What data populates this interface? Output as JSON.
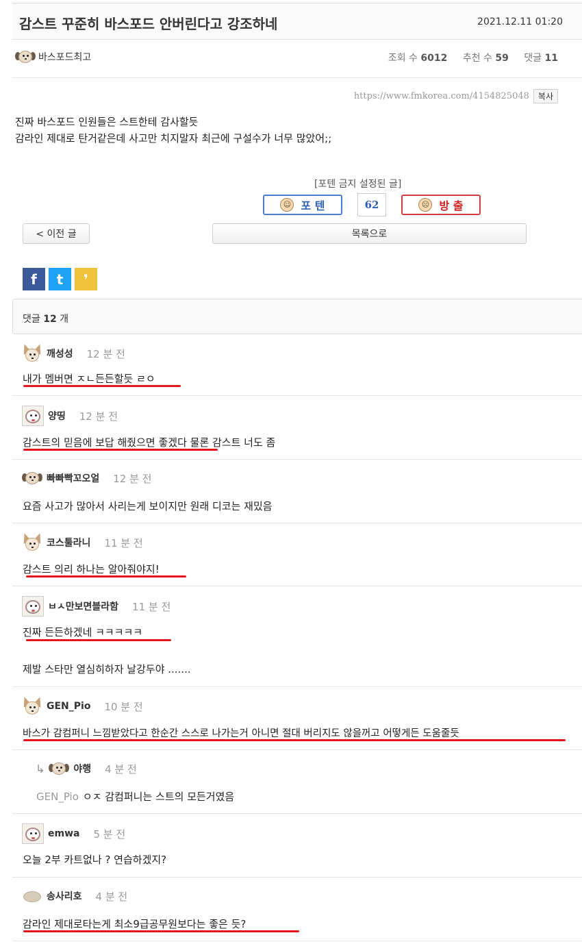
{
  "post": {
    "title": "감스트 꾸준히 바스포드 안버린다고 강조하네",
    "date": "2021.12.11 01:20",
    "author": "바스포드최고",
    "views_label": "조회 수",
    "views": "6012",
    "likes_label": "추천 수",
    "likes": "59",
    "comments_label": "댓글",
    "comments": "11",
    "url": "https://www.fmkorea.com/4154825048",
    "copy_label": "복사",
    "body_lines": [
      "진짜 바스포드 인원들은 스트한테 감사할듯",
      "감라인 제대로 탄거같은데 사고만 치지말자 최근에 구설수가 너무 많았어;;"
    ]
  },
  "vote": {
    "ban_note": "[포텐 금지 설정된 글]",
    "up_label": "포 텐",
    "count": "62",
    "down_label": "방 출"
  },
  "nav": {
    "prev_label": "< 이전 글",
    "list_label": "목록으로"
  },
  "share": {
    "facebook": "f",
    "twitter": "t",
    "kakao": "❜"
  },
  "comment_header": {
    "prefix": "댓글",
    "count": "12",
    "suffix": "개"
  },
  "comments": [
    {
      "avatar": "fox-icon",
      "name": "깨성성",
      "time": "12 분 전",
      "text": "내가 멤버면 ㅈㄴ든든할듯 ㄹㅇ"
    },
    {
      "avatar": "puppy-icon",
      "name": "양띵",
      "time": "12 분 전",
      "text": "감스트의 믿음에 보답 해줬으면 좋겠다 물론 감스트 너도 좀"
    },
    {
      "avatar": "dog-icon",
      "name": "빠빠빡꼬오얼",
      "time": "12 분 전",
      "text": "요즘 사고가 많아서 사리는게 보이지만 원래 디코는 재밌음"
    },
    {
      "avatar": "fox-icon",
      "name": "코스툴라니",
      "time": "11 분 전",
      "text": "감스트 의리 하나는 알아줘야지!"
    },
    {
      "avatar": "puppy-icon",
      "name": "ㅂㅅ만보면블라함",
      "time": "11 분 전",
      "text": "진짜 든든하겠네 ㅋㅋㅋㅋㅋ",
      "text2": "제발 스타만 열심히하자 날강두야 ......."
    },
    {
      "avatar": "fox-icon",
      "name": "GEN_Pio",
      "time": "10 분 전",
      "text": "바스가 감컴퍼니 느낌받았다고 한순간 스스로 나가는거 아니면 절대 버리지도 않을꺼고 어떻게든 도움줄듯"
    },
    {
      "avatar": "dog-icon",
      "name": "야행",
      "time": "4 분 전",
      "reply_to": "GEN_Pio",
      "text": "ㅇㅈ 감컴퍼니는 스트의 모든거였음"
    },
    {
      "avatar": "puppy-icon",
      "name": "emwa",
      "time": "5 분 전",
      "text": "오늘 2부 카트없나 ? 연습하겠지?"
    },
    {
      "avatar": "blob-icon",
      "name": "송사리호",
      "time": "4 분 전",
      "text": "감라인 제대로타는게 최소9급공무원보다는 좋은 듯?"
    }
  ]
}
